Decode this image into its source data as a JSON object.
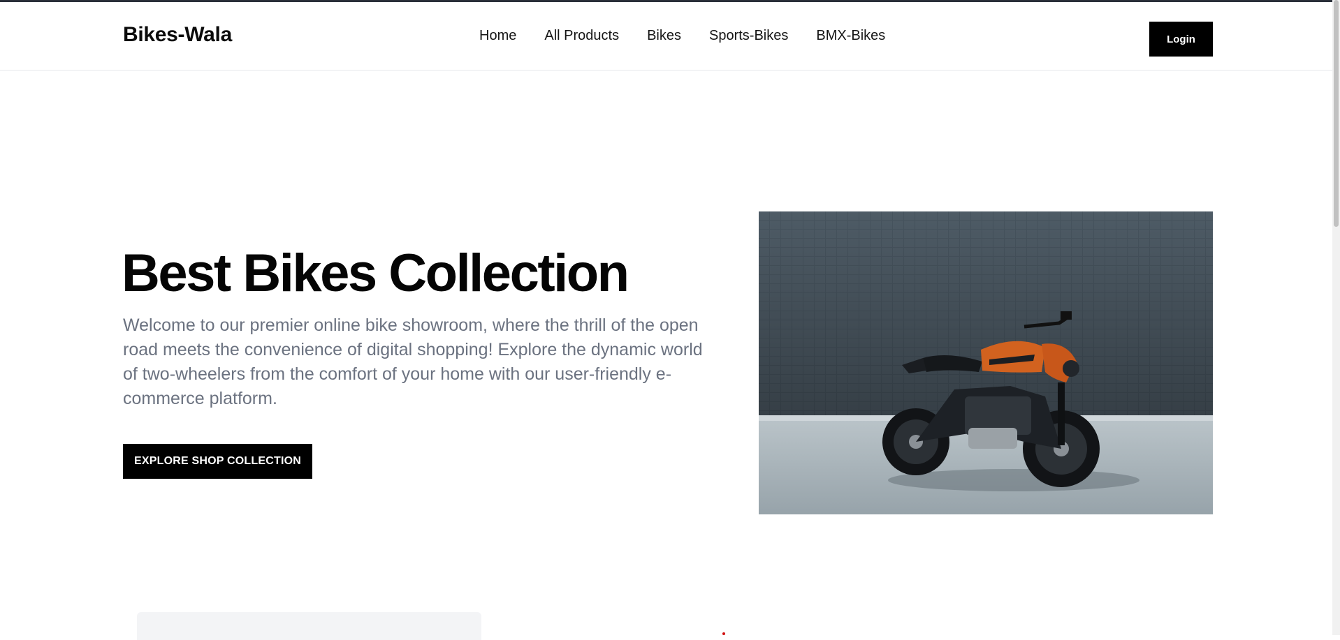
{
  "header": {
    "brand": "Bikes-Wala",
    "nav": [
      "Home",
      "All Products",
      "Bikes",
      "Sports-Bikes",
      "BMX-Bikes"
    ],
    "login_label": "Login"
  },
  "hero": {
    "title": "Best Bikes Collection",
    "description": "Welcome to our premier online bike showroom, where the thrill of the open road meets the convenience of digital shopping! Explore the dynamic world of two-wheelers from the comfort of your home with our user-friendly e-commerce platform.",
    "button_label": "EXPLORE SHOP COLLECTION"
  },
  "colors": {
    "primary_button": "#000000",
    "text_muted": "#6b7280",
    "wall": "#46535e",
    "bike_accent": "#d2621f"
  }
}
